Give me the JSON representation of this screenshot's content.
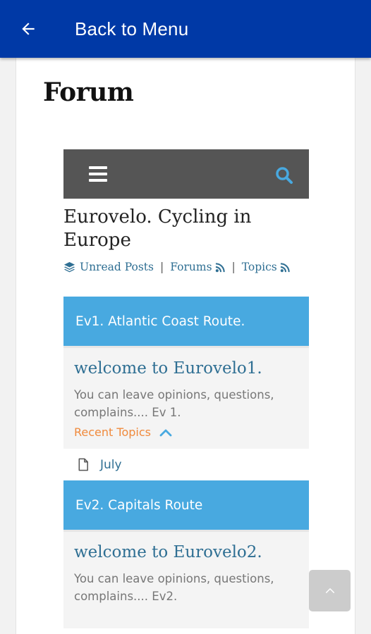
{
  "appbar": {
    "title": "Back to Menu",
    "color": "#0039a6"
  },
  "page": {
    "title": "Forum"
  },
  "forum": {
    "name": "Eurovelo. Cycling in Europe",
    "links": [
      {
        "label": "Unread Posts",
        "icon": "layers-icon"
      },
      {
        "label": "Forums",
        "icon": "rss-icon"
      },
      {
        "label": "Topics",
        "icon": "rss-icon"
      }
    ],
    "separator": "|",
    "cards": [
      {
        "header": "Ev1. Atlantic Coast Route.",
        "title": "welcome to Eurovelo1.",
        "description": "You can leave opinions, questions, complains.... Ev 1.",
        "recent_label": "Recent Topics",
        "topics": [
          "July"
        ]
      },
      {
        "header": "Ev2. Capitals Route",
        "title": "welcome to Eurovelo2.",
        "description": "You can leave opinions, questions, complains.... Ev2."
      }
    ]
  },
  "colors": {
    "header_blue": "#48a9e0",
    "link": "#2f6f93",
    "accent": "#f08a3c",
    "navbar": "#555555"
  }
}
